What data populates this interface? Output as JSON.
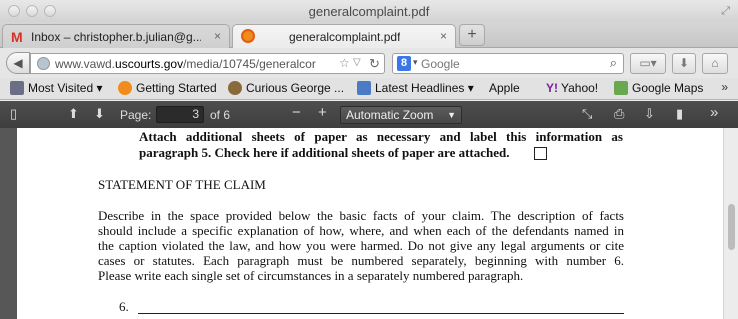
{
  "window": {
    "title": "generalcomplaint.pdf"
  },
  "tabs": [
    {
      "label": "Inbox – christopher.b.julian@g...",
      "close": "×"
    },
    {
      "label": "generalcomplaint.pdf",
      "close": "×"
    }
  ],
  "new_tab_label": "+",
  "navbar": {
    "url_host_prefix": "www.vawd.",
    "url_host_main": "uscourts.gov",
    "url_path": "/media/10745/generalcor",
    "search_placeholder": "Google"
  },
  "bookmarks": [
    {
      "label": "Most Visited ▾"
    },
    {
      "label": "Getting Started"
    },
    {
      "label": "Curious George ..."
    },
    {
      "label": "Latest Headlines ▾"
    },
    {
      "label": "Apple"
    },
    {
      "label": "Yahoo!"
    },
    {
      "label": "Google Maps"
    }
  ],
  "bookmarks_more": "»",
  "pdf_toolbar": {
    "page_label": "Page:",
    "page_value": "3",
    "page_of": "of 6",
    "zoom_value": "Automatic Zoom"
  },
  "document": {
    "attach_line1": "Attach additional sheets of paper as necessary and label this information as",
    "attach_line2": "paragraph 5.  Check here if additional sheets of paper are attached.",
    "heading": "STATEMENT OF THE CLAIM",
    "body_lines": [
      "Describe in the space provided below the basic facts of your claim.  The description of facts",
      "should include a specific explanation of how, where, and when each of the defendants named in",
      "the caption violated the law, and how you were harmed.  Do not give any legal arguments or cite",
      "cases or statutes.  Each paragraph must be numbered separately, beginning with number 6.",
      "Please write each single set of circumstances in a separately numbered paragraph."
    ],
    "paragraph_number": "6."
  },
  "colors": {
    "pdf_toolbar_bg": "#444444",
    "viewer_bg": "#575757",
    "gmail_red": "#d93025",
    "firefox_orange": "#f08c1b"
  }
}
